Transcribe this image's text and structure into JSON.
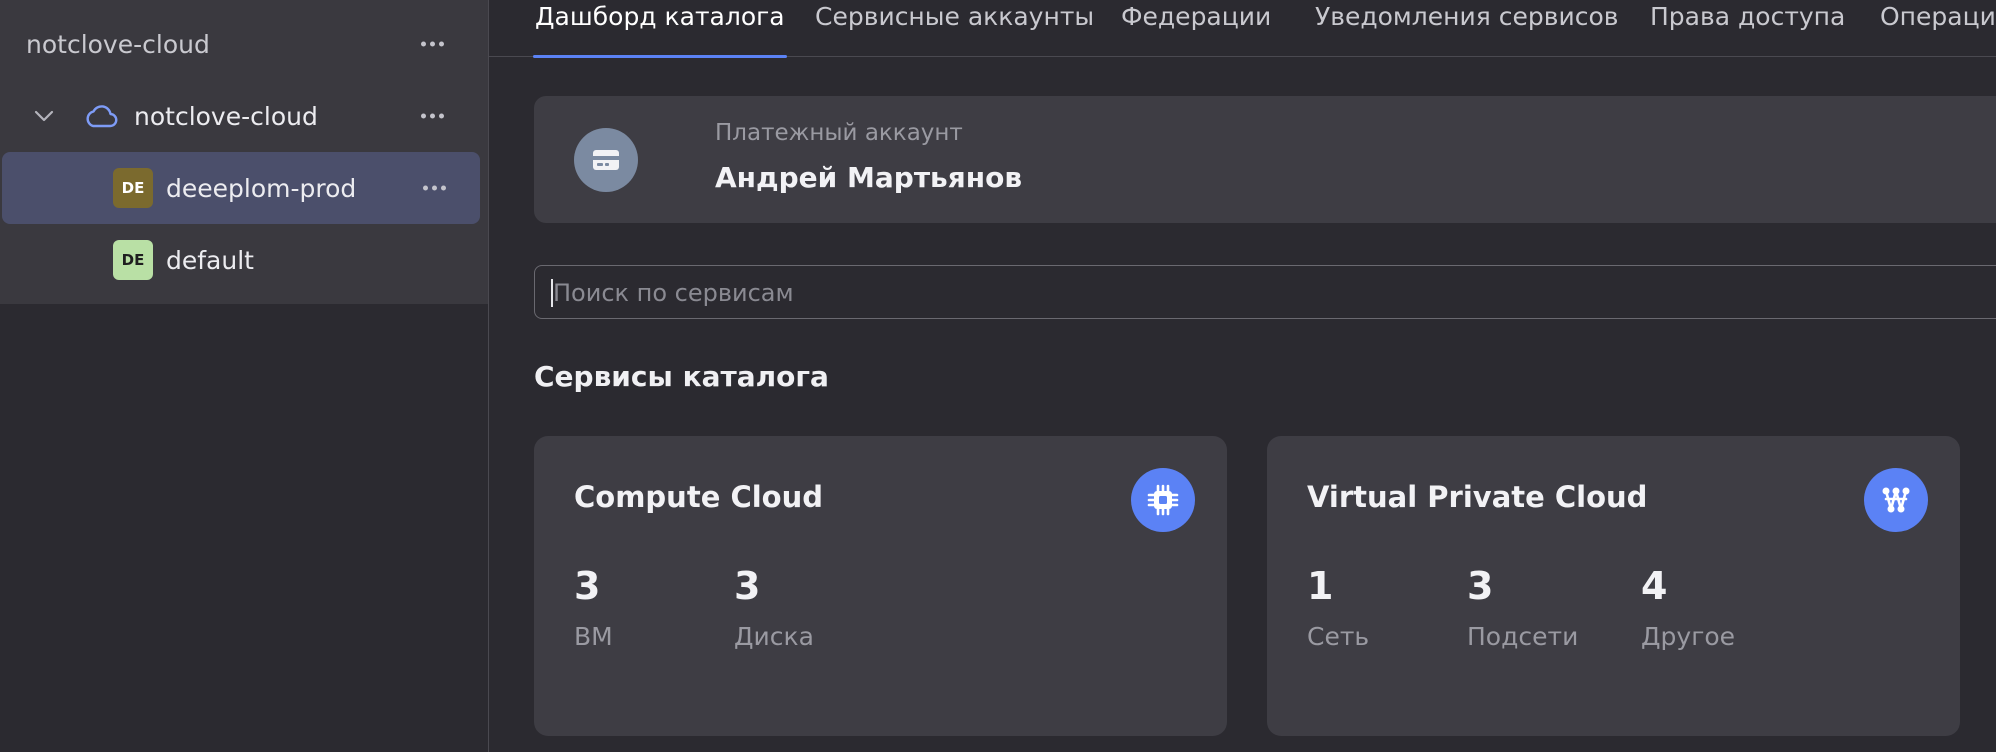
{
  "sidebar": {
    "cloud_name": "notclove-cloud",
    "tree": {
      "cloud_label": "notclove-cloud",
      "folders": [
        {
          "badge": "DE",
          "label": "deeeplom-prod",
          "badge_color": "#7b6a2e",
          "badge_text_color": "#ffffff",
          "selected": true
        },
        {
          "badge": "DE",
          "label": "default",
          "badge_color": "#b9e0a5",
          "badge_text_color": "#1f1f1f",
          "selected": false
        }
      ]
    }
  },
  "tabs": [
    {
      "label": "Дашборд каталога",
      "active": true
    },
    {
      "label": "Сервисные аккаунты"
    },
    {
      "label": "Федерации"
    },
    {
      "label": "Уведомления сервисов"
    },
    {
      "label": "Права доступа"
    },
    {
      "label": "Операции"
    }
  ],
  "billing": {
    "caption": "Платежный аккаунт",
    "name": "Андрей Мартьянов",
    "icon": "credit-card-icon"
  },
  "search": {
    "placeholder": "Поиск по сервисам",
    "value": ""
  },
  "services_section": {
    "title": "Сервисы каталога",
    "cards": [
      {
        "title": "Compute Cloud",
        "icon": "chip-icon",
        "metrics": [
          {
            "value": "3",
            "label": "ВМ"
          },
          {
            "value": "3",
            "label": "Диска"
          }
        ]
      },
      {
        "title": "Virtual Private Cloud",
        "icon": "network-icon",
        "metrics": [
          {
            "value": "1",
            "label": "Сеть"
          },
          {
            "value": "3",
            "label": "Подсети"
          },
          {
            "value": "4",
            "label": "Другое"
          }
        ]
      }
    ]
  },
  "colors": {
    "accent": "#5b82f5",
    "background": "#2b2a30",
    "card": "#3e3d44",
    "selected_row": "#4b4f6b"
  }
}
